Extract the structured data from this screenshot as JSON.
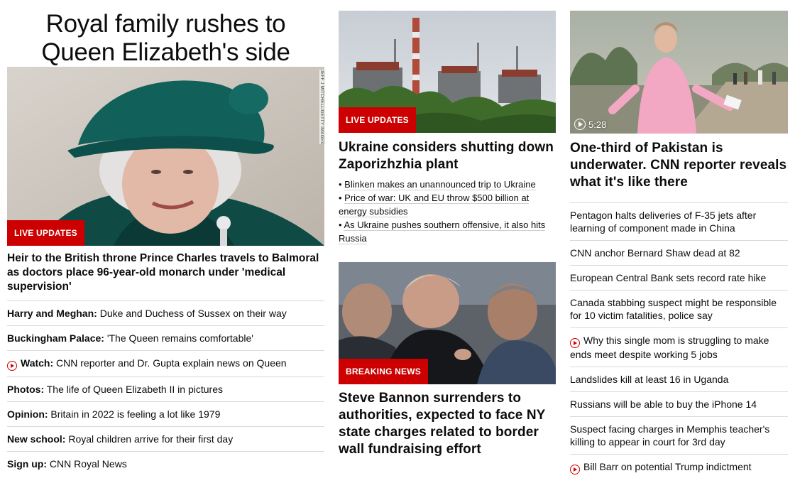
{
  "col1": {
    "headline": "Royal family rushes to Queen Elizabeth's side",
    "photo_credit": "JEFF J MITCHELL/GETTY IMAGES",
    "badge": "LIVE UPDATES",
    "lead_title": "Heir to the British throne Prince Charles travels to Balmoral as doctors place 96-year-old monarch under 'medical supervision'",
    "items": [
      {
        "bold": "Harry and Meghan:",
        "text": " Duke and Duchess of Sussex on their way",
        "icon": ""
      },
      {
        "bold": "Buckingham Palace:",
        "text": " 'The Queen remains comfortable'",
        "icon": ""
      },
      {
        "bold": "Watch:",
        "text": " CNN reporter and Dr. Gupta explain news on Queen",
        "icon": "play-icon"
      },
      {
        "bold": "Photos:",
        "text": " The life of Queen Elizabeth II in pictures",
        "icon": ""
      },
      {
        "bold": "Opinion:",
        "text": " Britain in 2022 is feeling a lot like 1979",
        "icon": ""
      },
      {
        "bold": "New school:",
        "text": " Royal children arrive for their first day",
        "icon": ""
      },
      {
        "bold": "Sign up:",
        "text": " CNN Royal News",
        "icon": ""
      }
    ]
  },
  "col2": {
    "story1": {
      "badge": "LIVE UPDATES",
      "title": "Ukraine considers shutting down Zaporizhzhia plant",
      "bullets": [
        "Blinken makes an unannounced trip to Ukraine",
        "Price of war: UK and EU throw $500 billion at energy subsidies",
        "As Ukraine pushes southern offensive, it also hits Russia"
      ]
    },
    "story2": {
      "badge": "BREAKING NEWS",
      "title": "Steve Bannon surrenders to authorities, expected to face NY state charges related to border wall fundraising effort"
    }
  },
  "col3": {
    "duration": "5:28",
    "title": "One-third of Pakistan is underwater. CNN reporter reveals what it's like there",
    "items": [
      {
        "text": "Pentagon halts deliveries of F-35 jets after learning of component made in China",
        "icon": ""
      },
      {
        "text": "CNN anchor Bernard Shaw dead at 82",
        "icon": ""
      },
      {
        "text": "European Central Bank sets record rate hike",
        "icon": ""
      },
      {
        "text": "Canada stabbing suspect might be responsible for 10 victim fatalities, police say",
        "icon": ""
      },
      {
        "text": "Why this single mom is struggling to make ends meet despite working 5 jobs",
        "icon": "play-icon"
      },
      {
        "text": "Landslides kill at least 16 in Uganda",
        "icon": ""
      },
      {
        "text": "Russians will be able to buy the iPhone 14",
        "icon": ""
      },
      {
        "text": "Suspect facing charges in Memphis teacher's killing to appear in court for 3rd day",
        "icon": ""
      },
      {
        "text": "Bill Barr on potential Trump indictment",
        "icon": "play-icon"
      }
    ]
  },
  "colors": {
    "accent": "#cc0000",
    "text": "#0c0c0c",
    "divider": "#d9d9d9"
  }
}
